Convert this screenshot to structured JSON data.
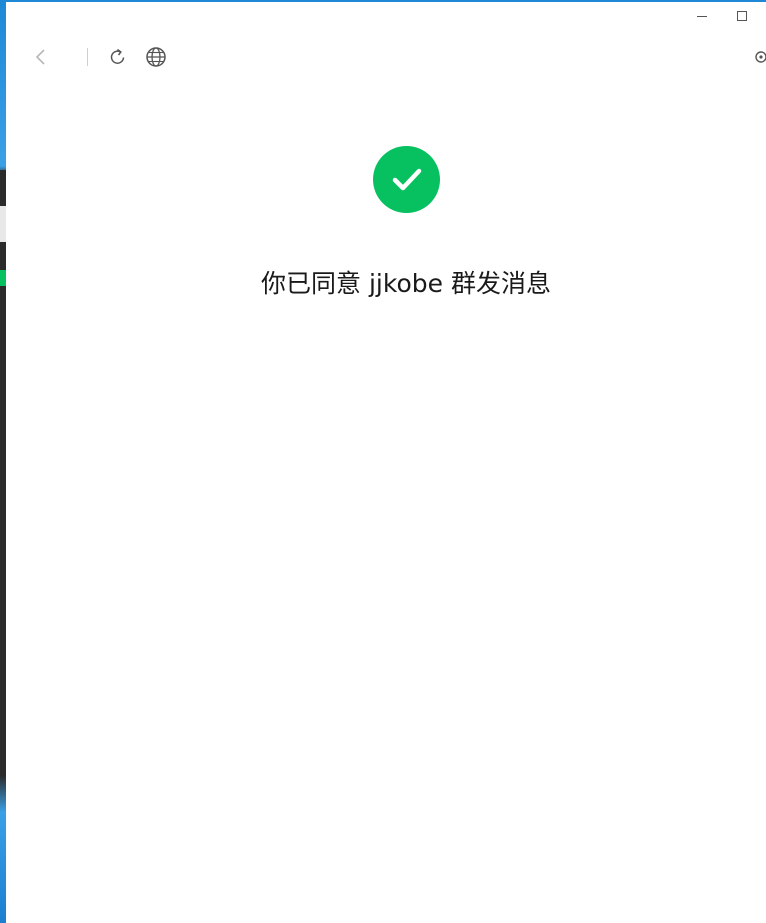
{
  "window": {
    "minimize_icon": "minimize-icon",
    "maximize_icon": "maximize-icon"
  },
  "toolbar": {
    "back_icon": "chevron-left-icon",
    "refresh_icon": "refresh-icon",
    "globe_icon": "globe-icon",
    "extra_icon": "circle-icon"
  },
  "result": {
    "status_icon": "check-circle-icon",
    "accent_color": "#07c160",
    "message": "你已同意 jjkobe 群发消息"
  }
}
